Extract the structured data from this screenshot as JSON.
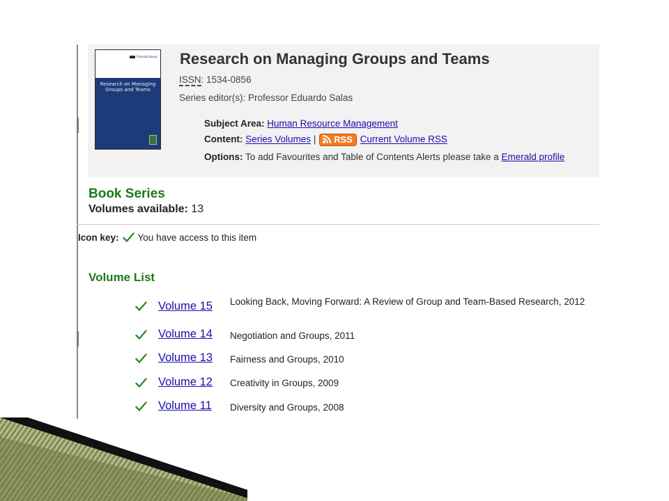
{
  "series": {
    "title": "Research on Managing Groups and Teams",
    "issn_label": "ISSN",
    "issn_value": ": 1534-0856",
    "editor": "Series editor(s): Professor Eduardo Salas",
    "cover": {
      "publisher": "Emerald Books",
      "title": "Research on Managing Groups and Teams"
    }
  },
  "meta": {
    "subject_label": "Subject Area:",
    "subject_link": "Human Resource Management",
    "content_label": "Content:",
    "series_volumes_link": "Series Volumes",
    "separator": "|",
    "rss_badge": "RSS",
    "current_volume_rss_link": "Current Volume RSS",
    "options_label": "Options:",
    "options_text": "To add Favourites and Table of Contents Alerts please take a",
    "profile_link": "Emerald profile"
  },
  "book_series": {
    "heading": "Book Series",
    "volumes_label": "Volumes available:",
    "volumes_count": "13"
  },
  "icon_key": {
    "label": "Icon key:",
    "text": "You have access to this item"
  },
  "volume_list": {
    "heading": "Volume List",
    "items": [
      {
        "link": "Volume 15",
        "desc": "Looking Back, Moving Forward: A Review of Group and Team-Based Research, 2012"
      },
      {
        "link": "Volume 14",
        "desc": "Negotiation and Groups, 2011"
      },
      {
        "link": "Volume 13",
        "desc": "Fairness and Groups, 2010"
      },
      {
        "link": "Volume 12",
        "desc": "Creativity in Groups, 2009"
      },
      {
        "link": "Volume 11",
        "desc": "Diversity and Groups, 2008"
      }
    ]
  },
  "colors": {
    "heading_green": "#1b7a1b",
    "link_blue": "#1a0dab",
    "rss_orange": "#f37a20",
    "check_green": "#2e8b2e",
    "cover_blue": "#1d3b78",
    "ribbon_dark": "#111111",
    "ribbon_olive": "#9aa06a"
  }
}
